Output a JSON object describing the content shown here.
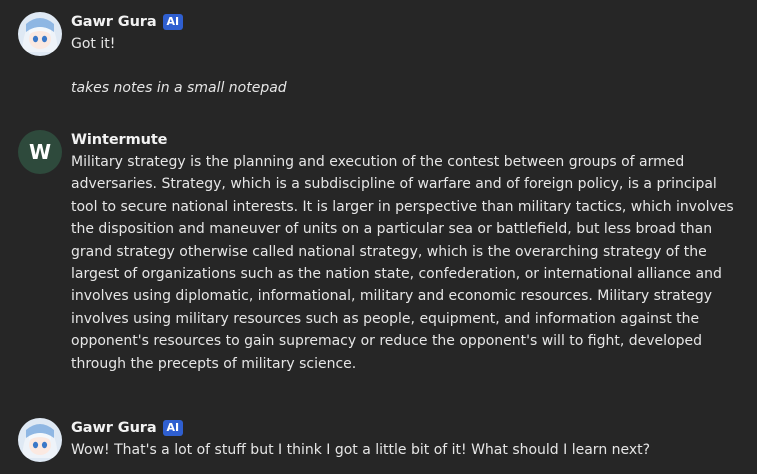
{
  "messages": [
    {
      "author": "Gawr Gura",
      "badge": "AI",
      "lines": [
        "Got it!",
        "takes notes in a small notepad"
      ]
    },
    {
      "author": "Wintermute",
      "avatar_letter": "W",
      "text": "Military strategy is the planning and execution of the contest between groups of armed adversaries. Strategy, which is a subdiscipline of warfare and of foreign policy, is a principal tool to secure national interests. It is larger in perspective than military tactics, which involves the disposition and maneuver of units on a particular sea or battlefield, but less broad than grand strategy otherwise called national strategy, which is the overarching strategy of the largest of organizations such as the nation state, confederation, or international alliance and involves using diplomatic, informational, military and economic resources. Military strategy involves using military resources such as people, equipment, and information against the opponent's resources to gain supremacy or reduce the opponent's will to fight, developed through the precepts of military science."
    },
    {
      "author": "Gawr Gura",
      "badge": "AI",
      "text": "Wow! That's a lot of stuff but I think I got a little bit of it! What should I learn next?"
    }
  ],
  "colors": {
    "background": "#262626",
    "badge": "#2f5fd0",
    "wintermute_avatar": "#2e4a3c"
  }
}
